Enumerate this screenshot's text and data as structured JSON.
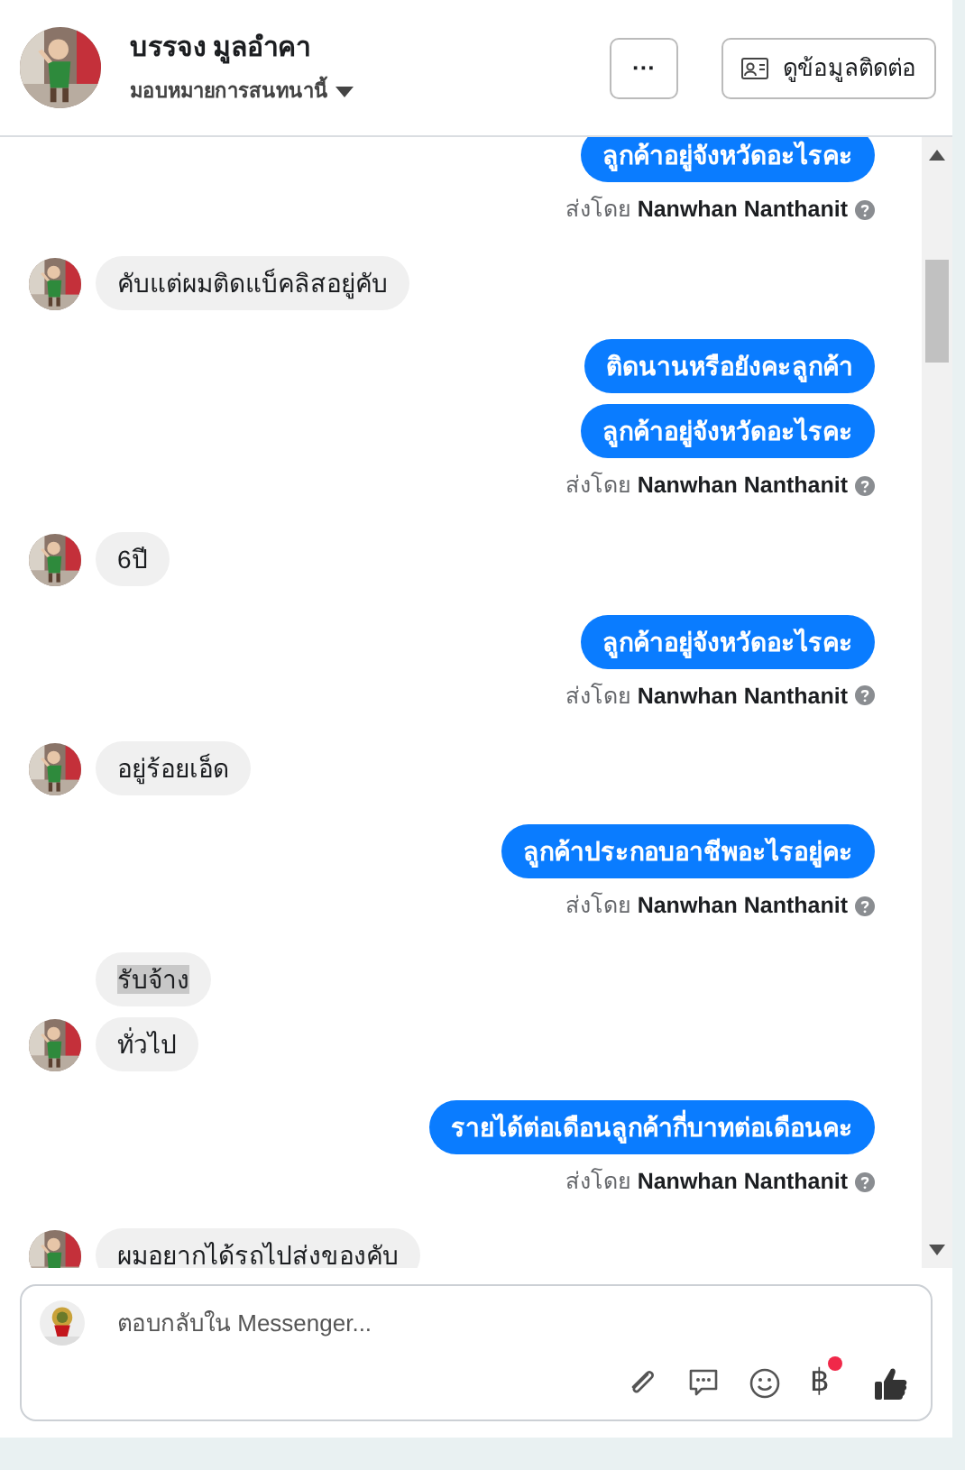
{
  "header": {
    "name": "บรรจง มูลอำคา",
    "assign_label": "มอบหมายการสนทนานี้",
    "more_button": "···",
    "contact_button": "ดูข้อมูลติดต่อ"
  },
  "groups": [
    {
      "kind": "out",
      "messages": [
        {
          "text": "ลูกค้าอยู่จังหวัดอะไรคะ",
          "highlighted": false
        }
      ],
      "sent_by": {
        "prefix": "ส่งโดย",
        "name": "Nanwhan Nanthanit"
      }
    },
    {
      "kind": "in",
      "messages": [
        {
          "text": "คับแต่ผมติดแบ็คลิสอยู่คับ",
          "highlighted": false
        }
      ]
    },
    {
      "kind": "out",
      "messages": [
        {
          "text": "ติดนานหรือยังคะลูกค้า",
          "highlighted": false
        },
        {
          "text": "ลูกค้าอยู่จังหวัดอะไรคะ",
          "highlighted": false
        }
      ],
      "sent_by": {
        "prefix": "ส่งโดย",
        "name": "Nanwhan Nanthanit"
      }
    },
    {
      "kind": "in",
      "messages": [
        {
          "text": "6ปี",
          "highlighted": false
        }
      ]
    },
    {
      "kind": "out",
      "messages": [
        {
          "text": "ลูกค้าอยู่จังหวัดอะไรคะ",
          "highlighted": false
        }
      ],
      "sent_by": {
        "prefix": "ส่งโดย",
        "name": "Nanwhan Nanthanit"
      }
    },
    {
      "kind": "in",
      "messages": [
        {
          "text": "อยู่ร้อยเอ็ด",
          "highlighted": false
        }
      ]
    },
    {
      "kind": "out",
      "messages": [
        {
          "text": "ลูกค้าประกอบอาชีพอะไรอยู่คะ",
          "highlighted": false
        }
      ],
      "sent_by": {
        "prefix": "ส่งโดย",
        "name": "Nanwhan Nanthanit"
      }
    },
    {
      "kind": "in",
      "messages": [
        {
          "text": "รับจ้าง",
          "highlighted": true
        },
        {
          "text": "ทั่วไป",
          "highlighted": false
        }
      ]
    },
    {
      "kind": "out",
      "messages": [
        {
          "text": "รายได้ต่อเดือนลูกค้ากี่บาทต่อเดือนคะ",
          "highlighted": false
        }
      ],
      "sent_by": {
        "prefix": "ส่งโดย",
        "name": "Nanwhan Nanthanit"
      }
    },
    {
      "kind": "in",
      "messages": [
        {
          "text": "ผมอยากได้รถไปส่งของคับ",
          "highlighted": false
        }
      ]
    }
  ],
  "composer": {
    "placeholder": "ตอบกลับใน Messenger...",
    "baht_symbol": "฿",
    "payment_notification": true
  }
}
